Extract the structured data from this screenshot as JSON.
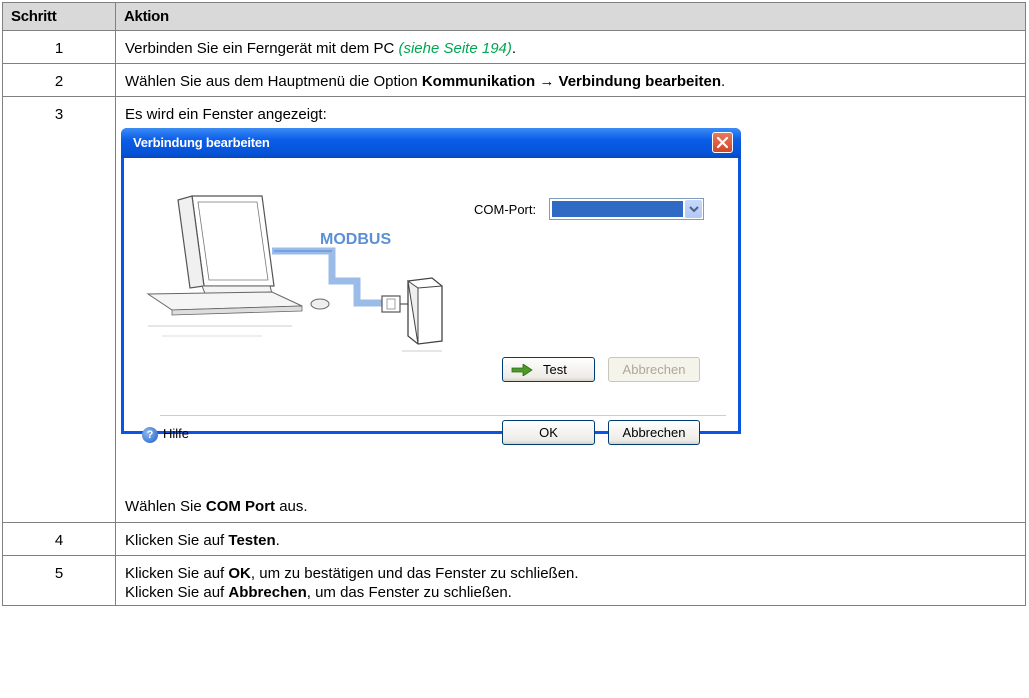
{
  "table": {
    "headers": [
      "Schritt",
      "Aktion"
    ],
    "rows": [
      {
        "num": "1",
        "text_before": "Verbinden Sie ein Ferngerät mit dem PC ",
        "link": "(siehe Seite 194)",
        "text_after": "."
      },
      {
        "num": "2",
        "text_before": "Wählen Sie aus dem Hauptmenü die Option ",
        "bold": "Kommunikation → Verbindung bearbeiten",
        "text_after": "."
      },
      {
        "num": "3",
        "text_before": "Es wird ein Fenster angezeigt:",
        "tail_before": "Wählen Sie ",
        "tail_bold": "COM Port",
        "tail_after": " aus."
      },
      {
        "num": "4",
        "text_before": "Klicken Sie auf ",
        "bold": "Testen",
        "text_after": "."
      },
      {
        "num": "5",
        "line1_before": "Klicken Sie auf ",
        "line1_bold": "OK",
        "line1_after": ", um zu bestätigen und das Fenster zu schließen.",
        "line2_before": "Klicken Sie auf ",
        "line2_bold": "Abbrechen",
        "line2_after": ", um das Fenster zu schließen."
      }
    ]
  },
  "dialog": {
    "title": "Verbindung bearbeiten",
    "illustration_label": "MODBUS",
    "com_port_label": "COM-Port:",
    "test_label": "Test",
    "cancel_disabled_label": "Abbrechen",
    "ok_label": "OK",
    "cancel_label": "Abbrechen",
    "help_label": "Hilfe",
    "icons": [
      "close-icon",
      "dropdown-arrow-icon",
      "green-arrow-icon",
      "help-icon"
    ]
  },
  "colors": {
    "header_bg": "#d9d9d9",
    "link": "#00a651",
    "titlebar": "#0a5de8",
    "selection": "#316ac5"
  }
}
